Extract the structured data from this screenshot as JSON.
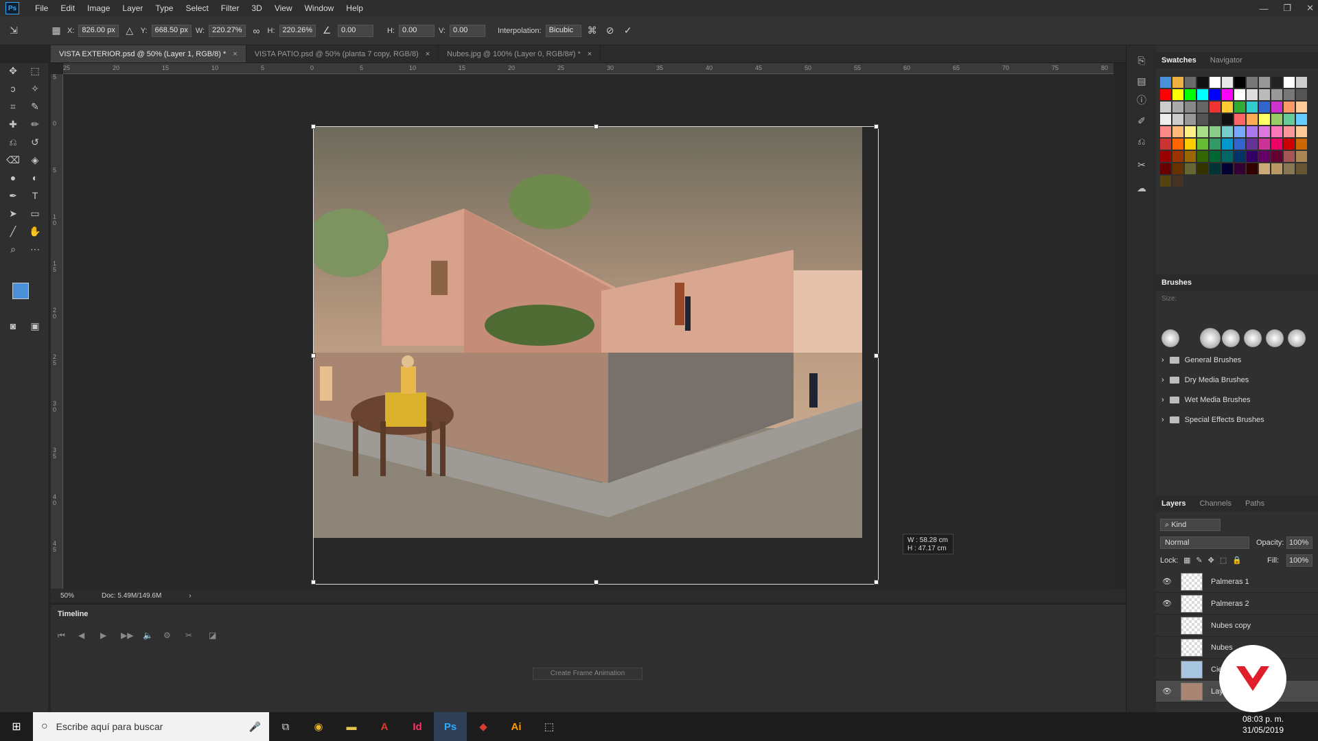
{
  "menubar": {
    "items": [
      "File",
      "Edit",
      "Image",
      "Layer",
      "Type",
      "Select",
      "Filter",
      "3D",
      "View",
      "Window",
      "Help"
    ],
    "logo": "Ps"
  },
  "options": {
    "x_label": "X:",
    "x": "826.00 px",
    "y_label": "Y:",
    "y": "668.50 px",
    "w_label": "W:",
    "w": "220.27%",
    "h_label": "H:",
    "h": "220.26%",
    "angle": "0.00",
    "hskew_label": "H:",
    "hskew": "0.00",
    "vskew_label": "V:",
    "vskew": "0.00",
    "interp_label": "Interpolation:",
    "interp": "Bicubic"
  },
  "tabs": [
    {
      "label": "VISTA EXTERIOR.psd @ 50% (Layer 1, RGB/8) *",
      "close": "×"
    },
    {
      "label": "VISTA PATIO.psd @ 50% (planta 7 copy, RGB/8)",
      "close": "×"
    },
    {
      "label": "Nubes.jpg @ 100% (Layer 0, RGB/8#) *",
      "close": "×"
    }
  ],
  "ruler": {
    "h": [
      "25",
      "20",
      "15",
      "10",
      "5",
      "0",
      "5",
      "10",
      "15",
      "20",
      "25",
      "30",
      "35",
      "40",
      "45",
      "50",
      "55",
      "60",
      "65",
      "70",
      "75",
      "80"
    ],
    "v": [
      "5",
      "0",
      "5",
      "1 0",
      "1 5",
      "2 0",
      "2 5",
      "3 0",
      "3 5",
      "4 0",
      "4 5"
    ]
  },
  "dim_tip": {
    "w": "W :  58.28 cm",
    "h": "H :  47.17 cm"
  },
  "status": {
    "zoom": "50%",
    "doc": "Doc: 5.49M/149.6M"
  },
  "timeline": {
    "title": "Timeline",
    "create": "Create Frame Animation"
  },
  "swatches": {
    "tab1": "Swatches",
    "tab2": "Navigator"
  },
  "brushes": {
    "title": "Brushes",
    "size_label": "Size:",
    "groups": [
      "General Brushes",
      "Dry Media Brushes",
      "Wet Media Brushes",
      "Special Effects Brushes"
    ]
  },
  "layers": {
    "tabs": [
      "Layers",
      "Channels",
      "Paths"
    ],
    "kind": "Kind",
    "blend": "Normal",
    "opacity_label": "Opacity:",
    "opacity": "100%",
    "lock_label": "Lock:",
    "fill_label": "Fill:",
    "fill": "100%",
    "items": [
      {
        "name": "Palmeras 1",
        "visible": "👁"
      },
      {
        "name": "Palmeras 2",
        "visible": "👁"
      },
      {
        "name": "Nubes copy",
        "visible": ""
      },
      {
        "name": "Nubes",
        "visible": ""
      },
      {
        "name": "Cielo",
        "visible": ""
      },
      {
        "name": "Layer 1",
        "visible": "👁"
      }
    ]
  },
  "taskbar": {
    "search": "Escribe aquí para buscar",
    "time": "08:03 p. m.",
    "date": "31/05/2019"
  },
  "icons": {
    "search": "search-icon",
    "windows": "windows-icon",
    "photoshop": "photoshop-icon",
    "illustrator": "illustrator-icon",
    "indesign": "indesign-icon",
    "acrobat": "acrobat-icon",
    "chrome": "chrome-icon",
    "explorer": "folder-icon"
  }
}
